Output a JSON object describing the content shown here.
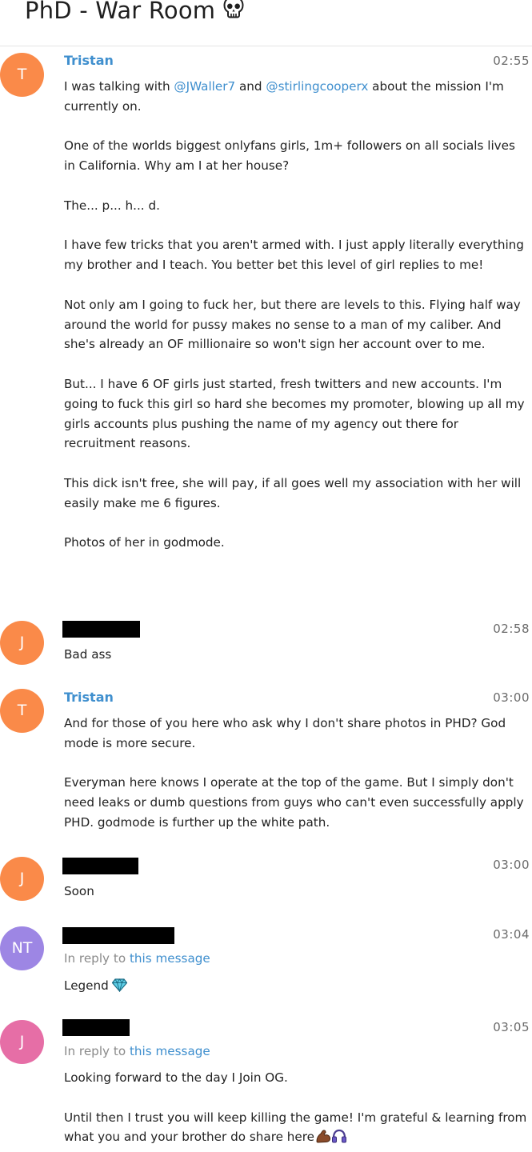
{
  "header": {
    "title": "PhD - War Room",
    "title_icon": "skull-icon"
  },
  "messages": [
    {
      "avatar": "T",
      "avatar_color": "#fa8a49",
      "sender": "Tristan",
      "time": "02:55",
      "line1_a": "I was talking with ",
      "mention1": "@JWaller7",
      "line1_b": " and ",
      "mention2": "@stirlingcooperx",
      "line1_c": " about the mission I'm currently on.",
      "p2": "One of the worlds biggest onlyfans girls, 1m+ followers on all socials lives in California. Why am I at her house?",
      "p3": "The... p... h... d.",
      "p4": "I have few tricks that you aren't armed with. I just apply literally everything my brother and I teach. You better bet this level of girl replies to me!",
      "p5": "Not only am I going to fuck her, but there are levels to this. Flying half way around the world for pussy makes no sense to a man of my caliber. And she's already an OF millionaire so won't sign her account over to me.",
      "p6": "But... I have 6 OF girls just started, fresh twitters and new accounts. I'm going to fuck this girl so hard she becomes my promoter, blowing up all my girls accounts plus pushing the name of my agency out there for recruitment reasons.",
      "p7": "This dick isn't free, she will pay, if all goes well my association with her will easily make me 6 figures.",
      "p8": "Photos of her in godmode."
    },
    {
      "avatar": "J",
      "avatar_color": "#fa8a49",
      "sender_redacted": true,
      "time": "02:58",
      "text": "Bad ass"
    },
    {
      "avatar": "T",
      "avatar_color": "#fa8a49",
      "sender": "Tristan",
      "time": "03:00",
      "p1": "And for those of you here who ask why I don't share photos in PHD? God mode is more secure.",
      "p2": "Everyman here knows I operate at the top of the game. But I simply don't need leaks or dumb questions from guys who can't even successfully apply PHD. godmode is further up the white path."
    },
    {
      "avatar": "J",
      "avatar_color": "#fa8a49",
      "sender_redacted": true,
      "time": "03:00",
      "text": "Soon"
    },
    {
      "avatar": "NT",
      "avatar_color": "#9d86e4",
      "sender_redacted": true,
      "time": "03:04",
      "reply_prefix": "In reply to ",
      "reply_link": "this message",
      "text": "Legend",
      "emoji": "gem-icon"
    },
    {
      "avatar": "J",
      "avatar_color": "#e66ea6",
      "sender_redacted": true,
      "time": "03:05",
      "reply_prefix": "In reply to ",
      "reply_link": "this message",
      "p1": "Looking forward to the day I Join OG.",
      "p2": "Until then I trust you will keep killing the game! I'm grateful & learning from what you and your brother do share here",
      "emoji1": "flexed-biceps-icon",
      "emoji2": "headphones-icon"
    }
  ]
}
